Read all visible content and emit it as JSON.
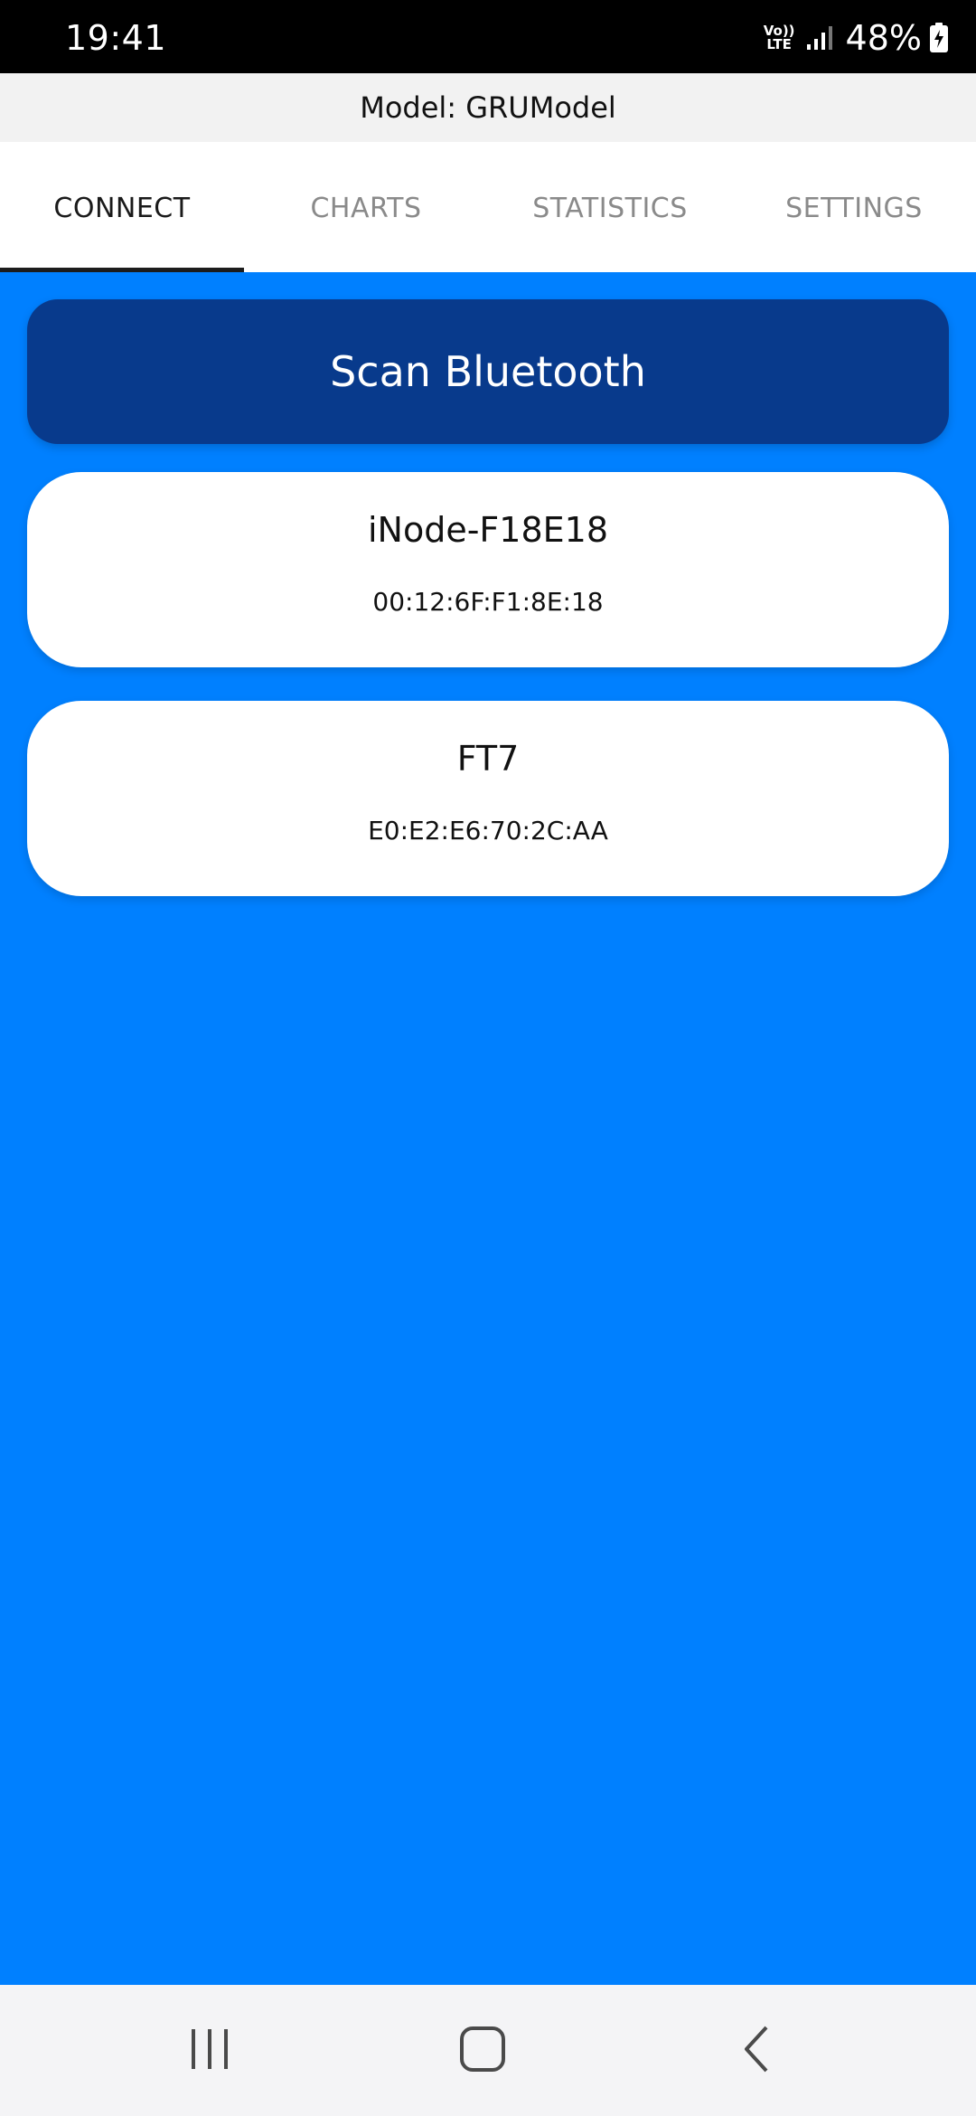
{
  "status_bar": {
    "time": "19:41",
    "network_label_top": "Vo))",
    "network_label_bottom": "LTE",
    "battery_percent": "48%",
    "icons": [
      "volte-icon",
      "signal-icon",
      "battery-charging-icon"
    ]
  },
  "header": {
    "model_label": "Model: GRUModel"
  },
  "tabs": [
    {
      "label": "CONNECT",
      "active": true
    },
    {
      "label": "CHARTS",
      "active": false
    },
    {
      "label": "STATISTICS",
      "active": false
    },
    {
      "label": "SETTINGS",
      "active": false
    }
  ],
  "main": {
    "scan_button_label": "Scan Bluetooth",
    "devices": [
      {
        "name": "iNode-F18E18",
        "mac": "00:12:6F:F1:8E:18"
      },
      {
        "name": "FT7",
        "mac": "E0:E2:E6:70:2C:AA"
      }
    ]
  },
  "nav_bar": {
    "icons": [
      "recent-apps-icon",
      "home-icon",
      "back-icon"
    ]
  },
  "colors": {
    "background": "#0080ff",
    "scan_button": "#083a8c",
    "card": "#ffffff",
    "tab_active_text": "#1a1a1a",
    "tab_inactive_text": "#8a8a8a"
  }
}
